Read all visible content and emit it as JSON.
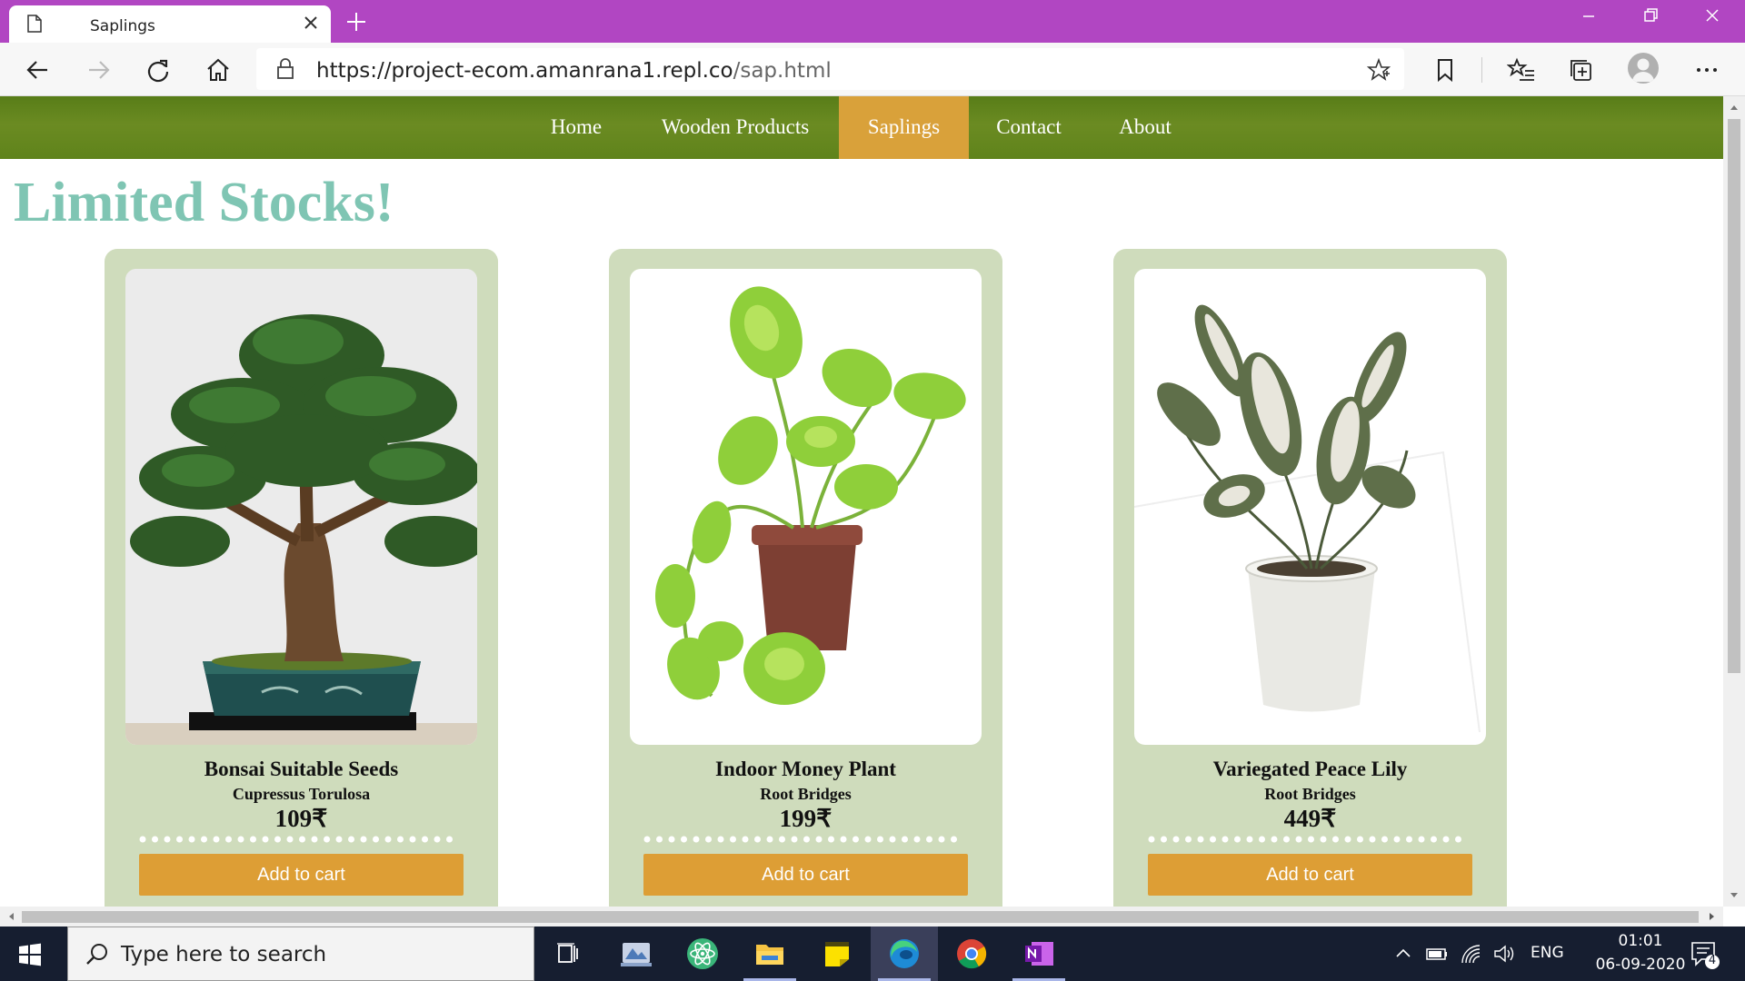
{
  "browser": {
    "tab_title": "Saplings",
    "url_base": "https://project-ecom.amanrana1.repl.co",
    "url_path": "/sap.html"
  },
  "site": {
    "nav": [
      {
        "label": "Home",
        "active": false
      },
      {
        "label": "Wooden Products",
        "active": false
      },
      {
        "label": "Saplings",
        "active": true
      },
      {
        "label": "Contact",
        "active": false
      },
      {
        "label": "About",
        "active": false
      }
    ],
    "headline": "Limited Stocks!",
    "products": [
      {
        "name": "Bonsai Suitable Seeds",
        "subtitle": "Cupressus Torulosa",
        "price": "109₹",
        "button": "Add to cart",
        "image": "bonsai-tree"
      },
      {
        "name": "Indoor Money Plant",
        "subtitle": "Root Bridges",
        "price": "199₹",
        "button": "Add to cart",
        "image": "money-plant"
      },
      {
        "name": "Variegated Peace Lily",
        "subtitle": "Root Bridges",
        "price": "449₹",
        "button": "Add to cart",
        "image": "peace-lily"
      }
    ],
    "colors": {
      "nav_green": "#6b8b22",
      "nav_active": "#d9a13a",
      "headline": "#7fc5b3",
      "card": "#cfdcbc",
      "button": "#dd9e35"
    }
  },
  "taskbar": {
    "search_placeholder": "Type here to search",
    "language": "ENG",
    "time": "01:01",
    "date": "06-09-2020",
    "notification_count": "4"
  }
}
